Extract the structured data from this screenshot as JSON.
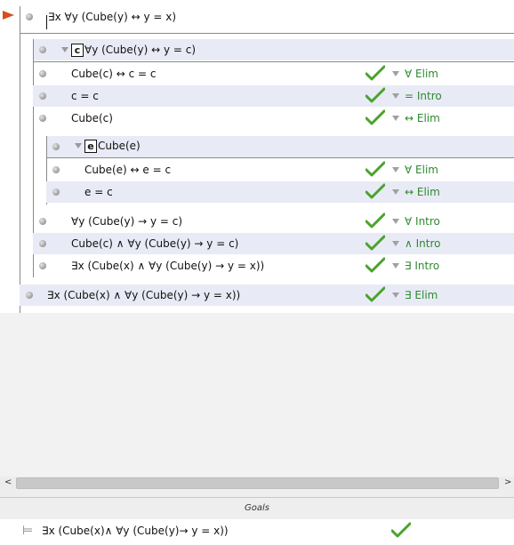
{
  "proof": {
    "premise": "∃x ∀y (Cube(y) ↔ y = x)",
    "subproof_outer": {
      "constant": "c",
      "assumption": "∀y (Cube(y) ↔ y = c)"
    },
    "subproof_inner": {
      "constant": "e",
      "assumption": "Cube(e)"
    },
    "steps": [
      {
        "formula": "Cube(c) ↔ c = c",
        "rule": "∀ Elim"
      },
      {
        "formula": "c = c",
        "rule": "= Intro"
      },
      {
        "formula": "Cube(c)",
        "rule": "↔ Elim"
      },
      {
        "formula": "Cube(e) ↔ e = c",
        "rule": "∀ Elim"
      },
      {
        "formula": "e = c",
        "rule": "↔ Elim"
      },
      {
        "formula": "∀y (Cube(y) → y = c)",
        "rule": "∀ Intro"
      },
      {
        "formula": "Cube(c) ∧ ∀y (Cube(y) → y = c)",
        "rule": "∧ Intro"
      },
      {
        "formula": "∃x (Cube(x) ∧ ∀y (Cube(y) → y = x))",
        "rule": "∃ Intro"
      },
      {
        "formula": "∃x (Cube(x) ∧ ∀y (Cube(y) → y = x))",
        "rule": "∃ Elim"
      }
    ]
  },
  "scrollbar": {
    "left_arrow": "<",
    "right_arrow": ">"
  },
  "goals": {
    "title": "Goals",
    "items": [
      {
        "formula": "∃x (Cube(x)∧ ∀y (Cube(y)→ y = x))"
      }
    ]
  },
  "colors": {
    "rule_text": "#2f8a2f",
    "check": "#4aa32c",
    "pointer": "#d4501c",
    "shaded_row": "#e8ebf6"
  },
  "icons": {
    "pointer": "focus-pointer-icon",
    "check": "checkmark-icon",
    "goal": "fitch-turnstile-icon"
  }
}
